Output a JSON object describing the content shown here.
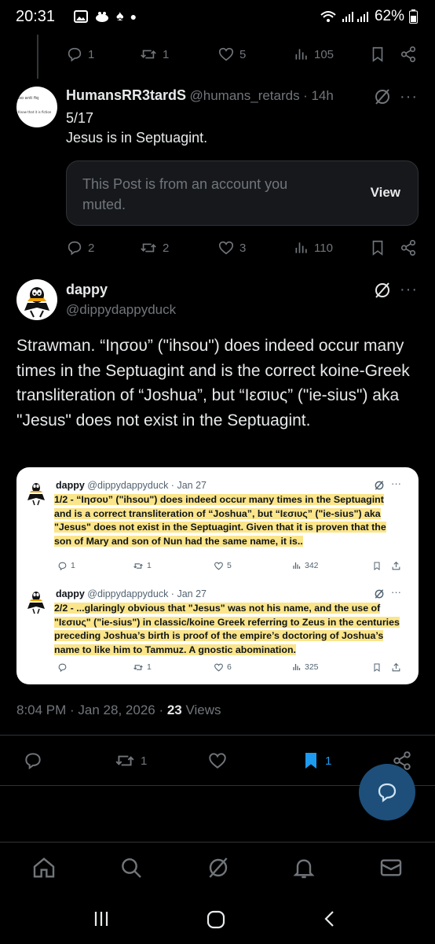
{
  "status_bar": {
    "time": "20:31",
    "battery": "62%"
  },
  "top_actions": {
    "replies": "1",
    "reposts": "1",
    "likes": "5",
    "views": "105"
  },
  "reply_tweet": {
    "author_name": "HumansRR3tardS",
    "handle": "@humans_retards",
    "time_ago": "· 14h",
    "counter": "5/17",
    "text": "Jesus is in Septuagint.",
    "avatar_text_1": "lso anti fiq",
    "avatar_text_2": "Know that it is fiction",
    "muted_message": "This Post is from an account you muted.",
    "view_label": "View",
    "actions": {
      "replies": "2",
      "reposts": "2",
      "likes": "3",
      "views": "110"
    }
  },
  "main_tweet": {
    "author_name": "dappy",
    "handle": "@dippydappyduck",
    "text": "Strawman. “Ιησου” (\"ihsou\") does indeed occur many times in the Septuagint and is the correct koine-Greek transliteration of “Joshua”, but “Ιεσιυς” (\"ie-sius\") aka \"Jesus\" does not exist in the Septuagint.",
    "timestamp": "8:04 PM · Jan 28, 2026 · ",
    "views_count": "23",
    "views_label": " Views",
    "actions": {
      "reposts": "1",
      "bookmarks": "1"
    }
  },
  "quoted_screenshot": {
    "tweets": [
      {
        "name": "dappy",
        "handle_time": "@dippydappyduck · Jan 27",
        "text": "1/2 - “Ιησου” (\"ihsou\") does indeed occur many times in the Septuagint and is a correct transliteration of “Joshua”, but “Ιεσιυς” (\"ie-sius\") aka \"Jesus\" does not exist in the Septuagint. Given that it is proven that the son of Mary and son of Nun had the same name, it is..",
        "replies": "1",
        "reposts": "1",
        "likes": "5",
        "views": "342"
      },
      {
        "name": "dappy",
        "handle_time": "@dippydappyduck · Jan 27",
        "text": "2/2 - ...glaringly obvious that \"Jesus\" was not his name, and the use of \"Ιεσιυς\" (\"ie-sius\") in classic/koine Greek referring to Zeus in the centuries preceding Joshua’s birth is proof of the empire’s doctoring of Joshua’s name to like him to Tammuz. A gnostic abomination.",
        "replies": "",
        "reposts": "1",
        "likes": "6",
        "views": "325"
      }
    ]
  },
  "colors": {
    "background": "#000000",
    "text": "#e7e9ea",
    "muted": "#71767b",
    "accent": "#1d9bf0",
    "highlight": "#fbe58a"
  },
  "icons": [
    "reply-icon",
    "repost-icon",
    "like-icon",
    "views-icon",
    "bookmark-icon",
    "share-icon",
    "grok-icon",
    "more-icon",
    "home-icon",
    "search-icon",
    "bell-icon",
    "mail-icon",
    "compose-icon"
  ]
}
